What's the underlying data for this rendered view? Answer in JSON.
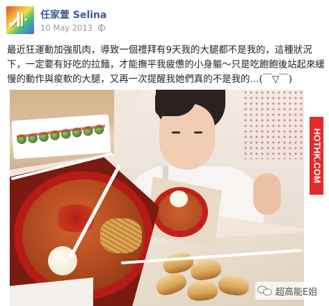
{
  "post": {
    "author": "任家萱 Selina",
    "date": "10 May 2013",
    "privacy_icon": "globe-icon",
    "text": "最近狂運動加強肌肉，導致一個禮拜有9天我的大腿都不是我的，這種狀況下，一定要有好吃的拉麵，才能撫平我疲憊的小身軀～只是吃飽飽後站起來緩慢的動作與痠軟的大腿，又再一次提醒我她們真的不是我的...(￣▽￣)"
  },
  "watermarks": {
    "side": "HOTHK.COM",
    "corner": "超高能E姐",
    "corner_icon": "wechat-icon",
    "side_color": "#e32b2b"
  },
  "colors": {
    "author_link": "#3b5998",
    "meta_text": "#90949c"
  }
}
